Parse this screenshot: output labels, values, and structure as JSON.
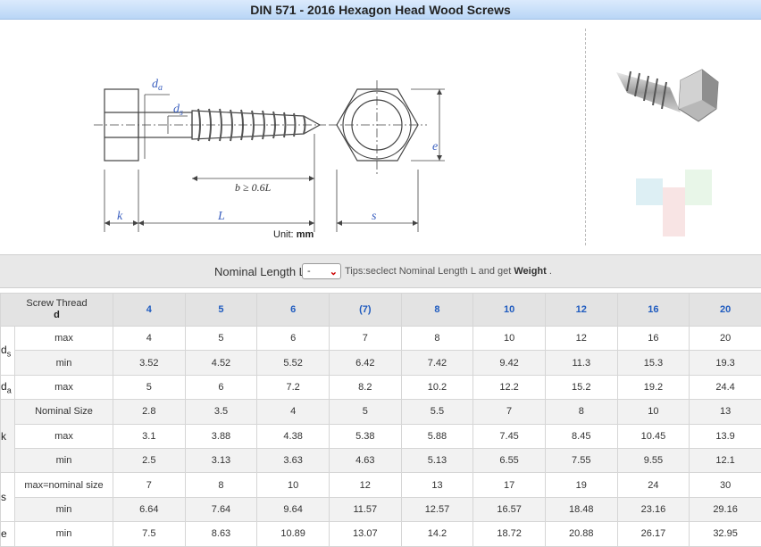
{
  "title": "DIN 571 - 2016 Hexagon Head Wood Screws",
  "drawing": {
    "labels": {
      "da": "d",
      "da_sub": "a",
      "ds": "d",
      "ds_sub": "s",
      "b": "b ≥ 0.6L",
      "e": "e",
      "k": "k",
      "L": "L",
      "s": "s"
    },
    "unit_label": "Unit:",
    "unit_value": "mm"
  },
  "selector": {
    "label": "Nominal Length L",
    "selected": "-",
    "tips_prefix": "Tips:seclect Nominal Length L and get",
    "tips_bold": "Weight",
    "tips_suffix": "."
  },
  "table": {
    "header": {
      "line1": "Screw Thread",
      "line2": "d"
    },
    "sizes": [
      "4",
      "5",
      "6",
      "(7)",
      "8",
      "10",
      "12",
      "16",
      "20"
    ],
    "rows": [
      {
        "dim": "d",
        "dim_sub": "s",
        "sub": "max",
        "values": [
          "4",
          "5",
          "6",
          "7",
          "8",
          "10",
          "12",
          "16",
          "20"
        ]
      },
      {
        "sub": "min",
        "values": [
          "3.52",
          "4.52",
          "5.52",
          "6.42",
          "7.42",
          "9.42",
          "11.3",
          "15.3",
          "19.3"
        ]
      },
      {
        "dim": "d",
        "dim_sub": "a",
        "sub": "max",
        "values": [
          "5",
          "6",
          "7.2",
          "8.2",
          "10.2",
          "12.2",
          "15.2",
          "19.2",
          "24.4"
        ]
      },
      {
        "dim": "k",
        "sub": "Nominal Size",
        "values": [
          "2.8",
          "3.5",
          "4",
          "5",
          "5.5",
          "7",
          "8",
          "10",
          "13"
        ]
      },
      {
        "sub": "max",
        "values": [
          "3.1",
          "3.88",
          "4.38",
          "5.38",
          "5.88",
          "7.45",
          "8.45",
          "10.45",
          "13.9"
        ]
      },
      {
        "sub": "min",
        "values": [
          "2.5",
          "3.13",
          "3.63",
          "4.63",
          "5.13",
          "6.55",
          "7.55",
          "9.55",
          "12.1"
        ]
      },
      {
        "dim": "s",
        "sub": "max=nominal size",
        "values": [
          "7",
          "8",
          "10",
          "12",
          "13",
          "17",
          "19",
          "24",
          "30"
        ]
      },
      {
        "sub": "min",
        "values": [
          "6.64",
          "7.64",
          "9.64",
          "11.57",
          "12.57",
          "16.57",
          "18.48",
          "23.16",
          "29.16"
        ]
      },
      {
        "dim": "e",
        "sub": "min",
        "values": [
          "7.5",
          "8.63",
          "10.89",
          "13.07",
          "14.2",
          "18.72",
          "20.88",
          "26.17",
          "32.95"
        ]
      }
    ]
  },
  "colors": {
    "size_header": "#1f5bbf",
    "title_bar": "#c4dcf7",
    "dim_label": "#3a5fbf"
  }
}
